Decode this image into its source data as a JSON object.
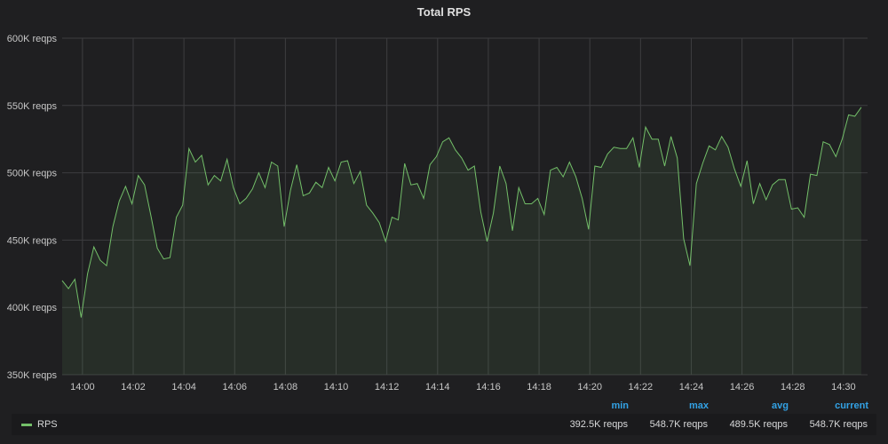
{
  "chart_data": {
    "type": "area",
    "title": "Total RPS",
    "unit_suffix": "K reqps",
    "ylim": [
      350,
      600
    ],
    "y_ticks": [
      "350K reqps",
      "400K reqps",
      "450K reqps",
      "500K reqps",
      "550K reqps",
      "600K reqps"
    ],
    "y_tick_values": [
      350,
      400,
      450,
      500,
      550,
      600
    ],
    "x_ticks": [
      "14:00",
      "14:02",
      "14:04",
      "14:06",
      "14:08",
      "14:10",
      "14:12",
      "14:14",
      "14:16",
      "14:18",
      "14:20",
      "14:22",
      "14:24",
      "14:26",
      "14:28",
      "14:30"
    ],
    "x_tick_minutes": [
      0,
      2,
      4,
      6,
      8,
      10,
      12,
      14,
      16,
      18,
      20,
      22,
      24,
      26,
      28,
      30
    ],
    "xlim_minutes_from_1400": [
      -0.8,
      30.95
    ],
    "x_start_minutes_from_1400": -0.8,
    "step_minutes": 0.25,
    "grid": true,
    "series": [
      {
        "name": "RPS",
        "color": "#73bf69",
        "values": [
          420,
          414,
          421,
          392.5,
          425,
          445,
          435,
          431,
          460,
          479,
          490,
          477,
          498,
          491,
          468,
          444,
          436,
          437,
          467,
          476,
          518,
          508,
          513,
          491,
          498,
          494,
          510,
          489,
          477,
          481,
          488,
          500,
          489,
          508,
          505,
          460,
          487,
          506,
          483,
          485,
          493,
          489,
          504,
          494,
          508,
          509,
          492,
          501,
          476,
          470,
          463,
          449,
          467,
          465,
          507,
          491,
          492,
          481,
          506,
          512,
          523,
          526,
          517,
          511,
          502,
          505,
          471,
          449,
          470,
          505,
          492,
          457,
          489,
          477,
          477,
          481,
          469,
          502,
          504,
          497,
          508,
          497,
          481,
          458,
          505,
          504,
          514,
          519,
          518,
          518,
          526,
          504,
          534,
          525,
          525,
          505,
          527,
          511,
          451,
          431,
          492,
          507,
          520,
          517,
          527,
          519,
          503,
          490,
          509,
          477,
          492,
          480,
          491,
          495,
          495,
          473,
          474,
          467,
          499,
          498,
          523,
          521,
          512,
          525,
          543,
          542,
          548.7
        ]
      }
    ],
    "legend": {
      "placement": "bottom",
      "headers": {
        "min": "min",
        "max": "max",
        "avg": "avg",
        "current": "current"
      },
      "rows": [
        {
          "name": "RPS",
          "min": "392.5K reqps",
          "max": "548.7K reqps",
          "avg": "489.5K reqps",
          "current": "548.7K reqps"
        }
      ]
    }
  }
}
